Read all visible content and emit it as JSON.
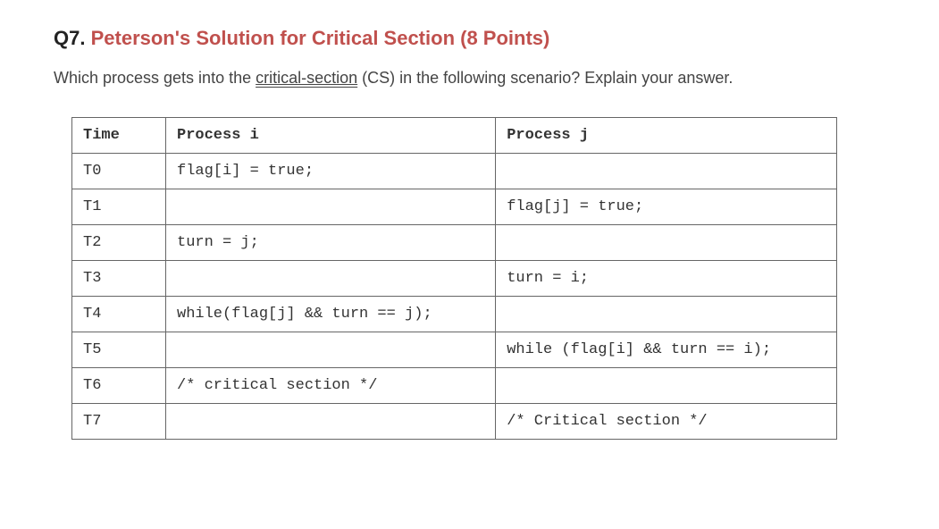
{
  "question": {
    "number": "Q7.",
    "title": "Peterson's Solution for Critical Section  (8 Points)",
    "body_pre": "Which process gets into the ",
    "body_term": "critical-section",
    "body_post": " (CS) in the following scenario? Explain your answer."
  },
  "table": {
    "headers": {
      "time": "Time",
      "proc_i": "Process i",
      "proc_j": "Process j"
    },
    "rows": [
      {
        "time": "T0",
        "proc_i": "flag[i] = true;",
        "proc_j": ""
      },
      {
        "time": "T1",
        "proc_i": "",
        "proc_j": "flag[j] = true;"
      },
      {
        "time": "T2",
        "proc_i": "turn = j;",
        "proc_j": ""
      },
      {
        "time": "T3",
        "proc_i": "",
        "proc_j": "turn = i;"
      },
      {
        "time": "T4",
        "proc_i": "while(flag[j] && turn == j);",
        "proc_j": ""
      },
      {
        "time": "T5",
        "proc_i": "",
        "proc_j": "while (flag[i] && turn == i);"
      },
      {
        "time": "T6",
        "proc_i": "/* critical section */",
        "proc_j": ""
      },
      {
        "time": "T7",
        "proc_i": "",
        "proc_j": "/* Critical section */"
      }
    ]
  }
}
